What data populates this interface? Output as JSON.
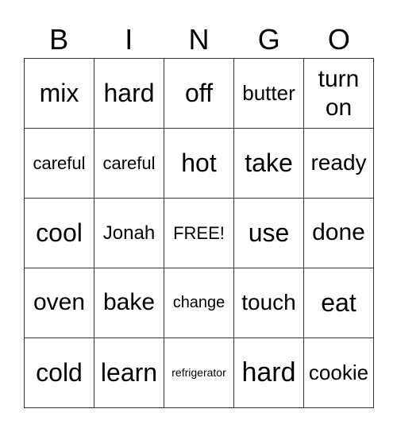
{
  "header": [
    "B",
    "I",
    "N",
    "G",
    "O"
  ],
  "rows": [
    [
      "mix",
      "hard",
      "off",
      "butter",
      "turn on"
    ],
    [
      "careful",
      "careful",
      "hot",
      "take",
      "ready"
    ],
    [
      "cool",
      "Jonah",
      "FREE!",
      "use",
      "done"
    ],
    [
      "oven",
      "bake",
      "change",
      "touch",
      "eat"
    ],
    [
      "cold",
      "learn",
      "refrigerator",
      "hard",
      "cookie"
    ]
  ]
}
